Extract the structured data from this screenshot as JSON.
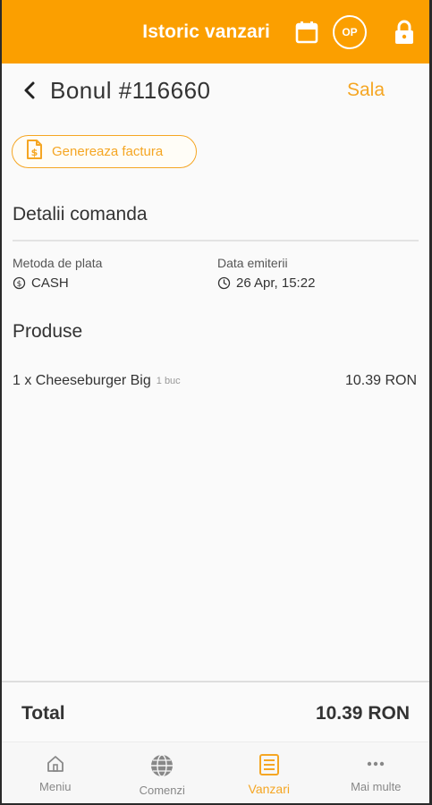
{
  "topbar": {
    "title": "Istoric vanzari",
    "user_initials": "OP",
    "accent_color": "#fb9f00",
    "icons": [
      "calendar-icon",
      "user-badge",
      "lock-icon"
    ]
  },
  "header": {
    "receipt_title": "Bonul #116660",
    "location_link": "Sala"
  },
  "actions": {
    "invoice_button": "Genereaza factura"
  },
  "details": {
    "section_title": "Detalii comanda",
    "payment_label": "Metoda de plata",
    "payment_value": "CASH",
    "date_label": "Data emiterii",
    "date_value": "26 Apr, 15:22"
  },
  "products": {
    "section_title": "Produse",
    "items": [
      {
        "name": "1 x Cheeseburger Big",
        "unit": "1 buc",
        "price": "10.39 RON"
      }
    ]
  },
  "total": {
    "label": "Total",
    "value": "10.39 RON"
  },
  "nav": {
    "items": [
      {
        "label": "Meniu",
        "icon": "home-icon",
        "active": false
      },
      {
        "label": "Comenzi",
        "icon": "globe-icon",
        "active": false
      },
      {
        "label": "Vanzari",
        "icon": "receipt-list-icon",
        "active": true
      },
      {
        "label": "Mai multe",
        "icon": "more-dots-icon",
        "active": false
      }
    ]
  }
}
